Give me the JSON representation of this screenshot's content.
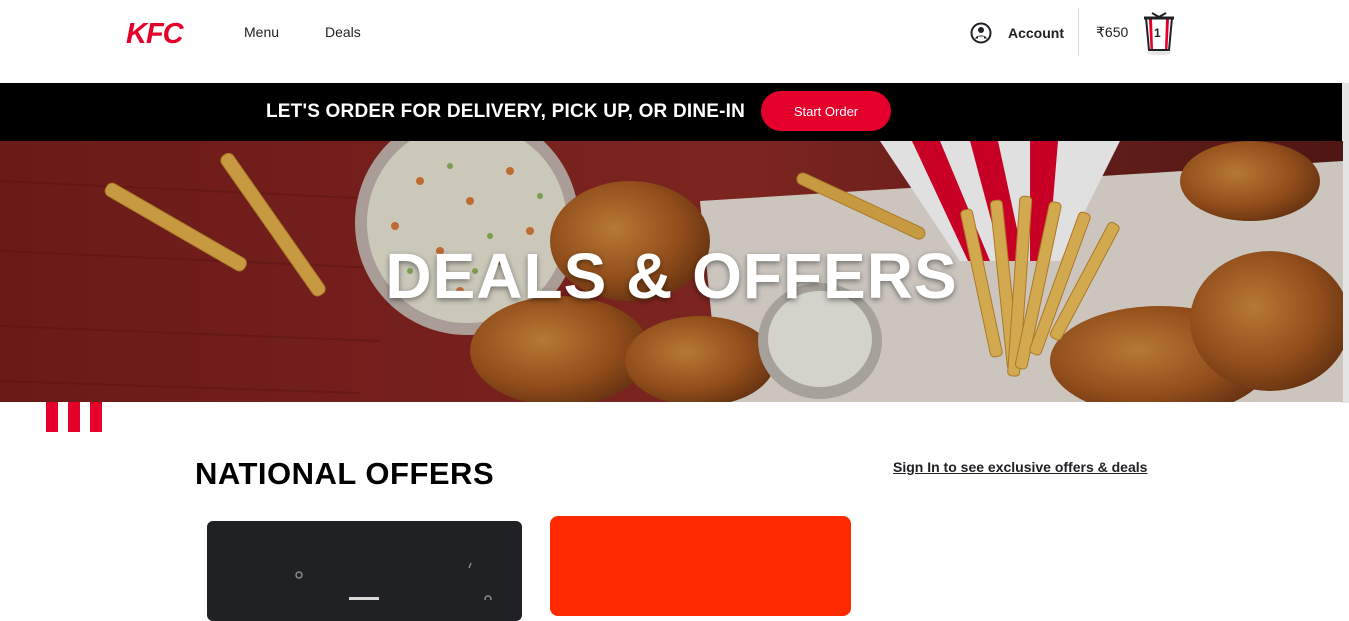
{
  "header": {
    "logo_text": "KFC",
    "nav": [
      {
        "label": "Menu"
      },
      {
        "label": "Deals"
      }
    ],
    "account_label": "Account",
    "cart_price": "₹650",
    "cart_count": "1"
  },
  "order_bar": {
    "text": "LET'S ORDER FOR DELIVERY, PICK UP, OR DINE-IN",
    "button_label": "Start Order"
  },
  "hero": {
    "title": "DEALS & OFFERS"
  },
  "offers": {
    "section_title": "NATIONAL OFFERS",
    "signin_link": "Sign In to see exclusive offers & deals"
  },
  "colors": {
    "brand_red": "#e4002b",
    "bar_black": "#000000",
    "offer_card_dark": "#202124",
    "offer_card_red": "#ff2a00"
  }
}
